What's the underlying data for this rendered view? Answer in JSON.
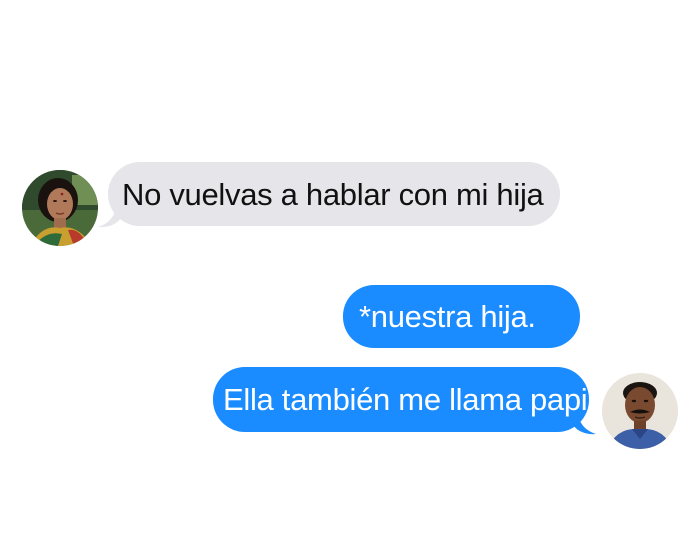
{
  "conversation": {
    "messages": [
      {
        "sender": "incoming",
        "text": "No vuelvas a hablar con mi hija"
      },
      {
        "sender": "outgoing",
        "text": "*nuestra hija."
      },
      {
        "sender": "outgoing",
        "text": "Ella también me llama papi"
      }
    ],
    "avatars": {
      "left": "woman-avatar",
      "right": "man-avatar"
    }
  },
  "colors": {
    "incoming_bubble": "#e5e5ea",
    "outgoing_bubble": "#1a8cff",
    "incoming_text": "#111111",
    "outgoing_text": "#ffffff",
    "background": "#ffffff"
  }
}
